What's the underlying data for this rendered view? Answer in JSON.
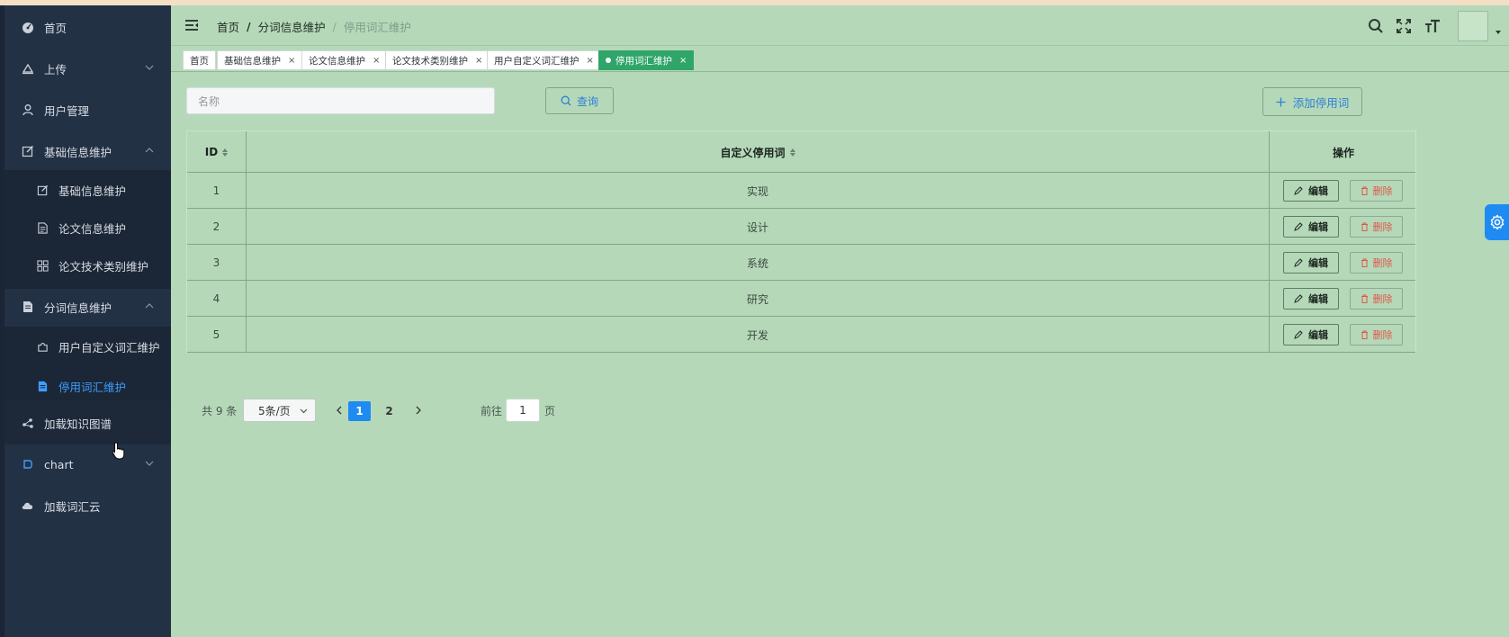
{
  "sidebar": {
    "items": [
      {
        "label": "首页",
        "icon": "dashboard-icon"
      },
      {
        "label": "上传",
        "icon": "upload-icon"
      },
      {
        "label": "用户管理",
        "icon": "user-icon"
      },
      {
        "label": "基础信息维护",
        "icon": "edit-icon"
      },
      {
        "label": "分词信息维护",
        "icon": "document-icon"
      },
      {
        "label": "加载知识图谱",
        "icon": "share-icon"
      },
      {
        "label": "chart",
        "icon": "chart-icon"
      },
      {
        "label": "加载词汇云",
        "icon": "cloud-icon"
      }
    ],
    "sub_basic": [
      {
        "label": "基础信息维护",
        "icon": "edit-icon"
      },
      {
        "label": "论文信息维护",
        "icon": "file-icon"
      },
      {
        "label": "论文技术类别维护",
        "icon": "grid-icon"
      }
    ],
    "sub_seg": [
      {
        "label": "用户自定义词汇维护",
        "icon": "puzzle-icon"
      },
      {
        "label": "停用词汇维护",
        "icon": "document-icon"
      }
    ]
  },
  "header": {
    "breadcrumb": [
      "首页",
      "分词信息维护",
      "停用词汇维护"
    ],
    "sep": "/"
  },
  "tabs": [
    {
      "label": "首页",
      "closable": false
    },
    {
      "label": "基础信息维护",
      "close": "×"
    },
    {
      "label": "论文信息维护",
      "close": "×"
    },
    {
      "label": "论文技术类别维护",
      "close": "×"
    },
    {
      "label": "用户自定义词汇维护",
      "close": "×"
    },
    {
      "label": "停用词汇维护",
      "close": "×"
    }
  ],
  "search": {
    "placeholder": "名称",
    "query_label": "查询",
    "add_label": "添加停用词"
  },
  "table": {
    "headers": {
      "id": "ID",
      "word": "自定义停用词",
      "ops": "操作"
    },
    "rows": [
      {
        "id": "1",
        "word": "实现"
      },
      {
        "id": "2",
        "word": "设计"
      },
      {
        "id": "3",
        "word": "系统"
      },
      {
        "id": "4",
        "word": "研究"
      },
      {
        "id": "5",
        "word": "开发"
      }
    ],
    "edit_label": "编辑",
    "delete_label": "删除"
  },
  "pagination": {
    "total_text": "共 9 条",
    "page_size": "5条/页",
    "pages": [
      "1",
      "2"
    ],
    "current": "1",
    "goto_label": "前往",
    "goto_value": "1",
    "page_suffix": "页"
  },
  "colors": {
    "sidebar_bg": "#233145",
    "main_bg": "#b5d9b8",
    "accent": "#1f8bf2",
    "active_tab": "#2fa56a",
    "delete": "#e0574c"
  }
}
